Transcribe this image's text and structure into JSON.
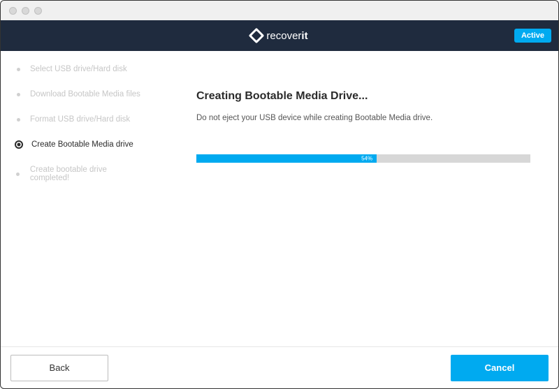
{
  "header": {
    "brand_prefix": "recover",
    "brand_suffix": "it",
    "active_label": "Active"
  },
  "sidebar": {
    "steps": [
      {
        "label": "Select USB drive/Hard disk",
        "active": false
      },
      {
        "label": "Download Bootable Media files",
        "active": false
      },
      {
        "label": "Format USB drive/Hard disk",
        "active": false
      },
      {
        "label": "Create Bootable Media drive",
        "active": true
      },
      {
        "label": "Create bootable drive completed!",
        "active": false
      }
    ]
  },
  "main": {
    "title": "Creating Bootable Media Drive...",
    "subtitle": "Do not eject your USB device while creating Bootable Media drive.",
    "progress_percent": 54,
    "progress_label": "54%"
  },
  "footer": {
    "back_label": "Back",
    "cancel_label": "Cancel"
  }
}
